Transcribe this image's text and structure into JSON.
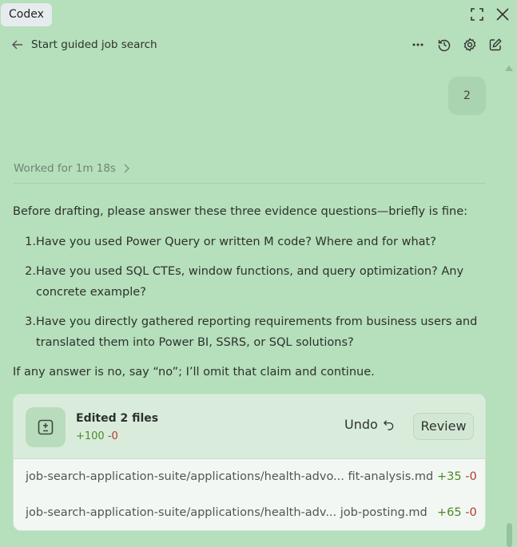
{
  "app": {
    "name": "Codex"
  },
  "header": {
    "title": "Start guided job search"
  },
  "icons": {
    "expand": "expand-icon",
    "close": "close-icon",
    "back": "arrow-left-icon",
    "more": "more-horizontal-icon",
    "history": "history-icon",
    "settings": "gear-icon",
    "edit": "compose-icon",
    "worked_chevron": "chevron-right-icon",
    "diff": "diff-file-icon",
    "undo": "undo-icon"
  },
  "conversation": {
    "user_message": "2",
    "worked_label": "Worked for 1m 18s",
    "intro": "Before drafting, please answer these three evidence questions—briefly is fine:",
    "questions": [
      {
        "num": "1.",
        "lines": [
          "Have you used Power Query or written M code? Where and for what?"
        ]
      },
      {
        "num": "2.",
        "lines": [
          "Have you used SQL CTEs, window functions, and query optimization? Any",
          "concrete example?"
        ]
      },
      {
        "num": "3.",
        "lines": [
          "Have you directly gathered reporting requirements from business users and",
          "translated them into Power BI, SSRS, or SQL solutions?"
        ]
      }
    ],
    "outro": "If any answer is no, say “no”; I’ll omit that claim and continue."
  },
  "edits": {
    "title": "Edited 2 files",
    "added": "+100",
    "removed": "-0",
    "undo_label": "Undo",
    "review_label": "Review",
    "files": [
      {
        "path": "job-search-application-suite/applications/health-advo... fit-analysis.md",
        "added": "+35",
        "removed": "-0"
      },
      {
        "path": "job-search-application-suite/applications/health-adv... job-posting.md",
        "added": "+65",
        "removed": "-0"
      }
    ]
  },
  "colors": {
    "background": "#b6dfbb",
    "added": "#4b8a2a",
    "removed": "#b23a2c"
  }
}
